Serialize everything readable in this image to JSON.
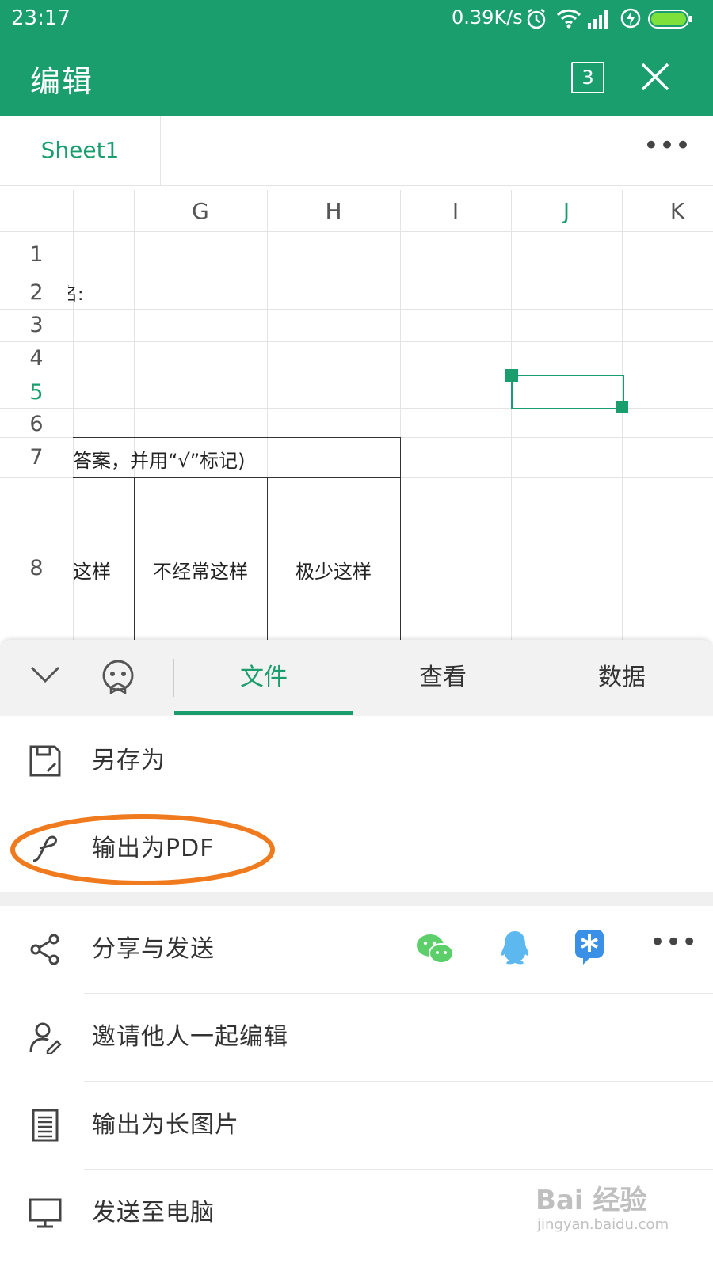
{
  "status_bar": {
    "time": "23:17",
    "network_speed": "0.39K/s",
    "icons": [
      "alarm-icon",
      "wifi-icon",
      "signal-icon",
      "charging-icon",
      "battery-icon"
    ]
  },
  "header": {
    "title": "编辑",
    "page_count": "3",
    "close_icon": "close-icon",
    "background": "#1a9e6e"
  },
  "sheet_tabs": {
    "active": "Sheet1",
    "more_icon": "more-horizontal-icon"
  },
  "grid": {
    "columns": [
      "G",
      "H",
      "I",
      "J",
      "K"
    ],
    "active_column": "J",
    "rows": [
      "1",
      "2",
      "3",
      "4",
      "5",
      "6",
      "7",
      "8"
    ],
    "active_row": "5",
    "cells": {
      "row2_fragment": "名:",
      "row7_text": "答案，并用“√”标记)",
      "row8_col_f": "这样",
      "row8_col_g": "不经常这样",
      "row8_col_h": "极少这样"
    }
  },
  "panel": {
    "collapse_icon": "chevron-down-icon",
    "assistant_icon": "assistant-face-icon",
    "tabs": [
      {
        "label": "文件",
        "active": true
      },
      {
        "label": "查看",
        "active": false
      },
      {
        "label": "数据",
        "active": false
      }
    ],
    "menu": [
      {
        "label": "另存为",
        "icon": "save-as-icon"
      },
      {
        "label": "输出为PDF",
        "icon": "pdf-export-icon"
      },
      {
        "label": "分享与发送",
        "icon": "share-icon"
      },
      {
        "label": "邀请他人一起编辑",
        "icon": "invite-user-icon"
      },
      {
        "label": "输出为长图片",
        "icon": "long-image-icon"
      },
      {
        "label": "发送至电脑",
        "icon": "computer-icon"
      }
    ],
    "share_targets": [
      "wechat-icon",
      "qq-icon",
      "dingtalk-icon",
      "more-horizontal-icon"
    ]
  },
  "watermark": {
    "text": "Bai 经验",
    "sub": "jingyan.baidu.com"
  },
  "colors": {
    "accent": "#1a9e6e",
    "highlight_ellipse": "#f07b1e"
  }
}
